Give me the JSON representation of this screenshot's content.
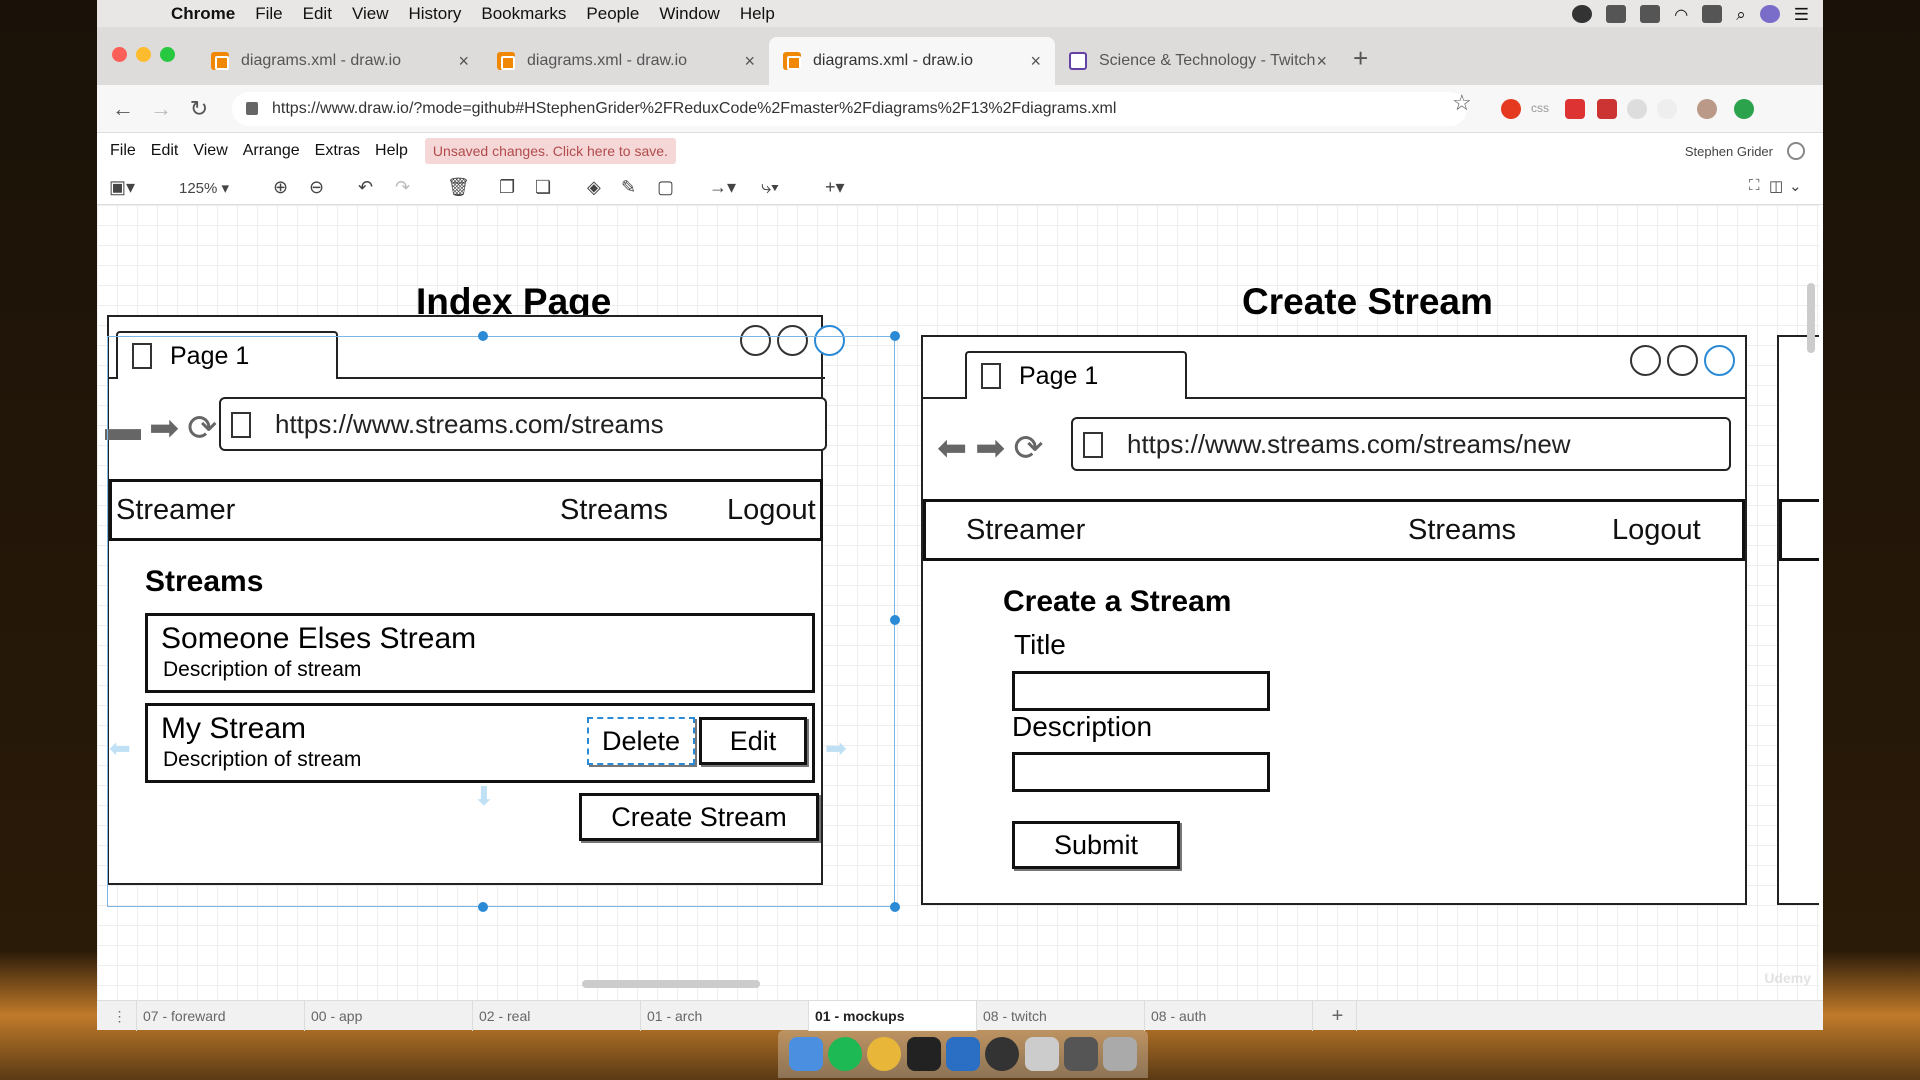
{
  "mac_menubar": {
    "items": [
      "Chrome",
      "File",
      "Edit",
      "View",
      "History",
      "Bookmarks",
      "People",
      "Window",
      "Help"
    ]
  },
  "chrome": {
    "tabs": [
      {
        "title": "diagrams.xml - draw.io",
        "active": false
      },
      {
        "title": "diagrams.xml - draw.io",
        "active": false
      },
      {
        "title": "diagrams.xml - draw.io",
        "active": true
      },
      {
        "title": "Science & Technology - Twitch",
        "active": false
      }
    ],
    "new_tab": "+",
    "url": "https://www.draw.io/?mode=github#HStephenGrider%2FReduxCode%2Fmaster%2Fdiagrams%2F13%2Fdiagrams.xml",
    "ext_label_css": "css"
  },
  "drawio": {
    "menu": [
      "File",
      "Edit",
      "View",
      "Arrange",
      "Extras",
      "Help"
    ],
    "unsaved_notice": "Unsaved changes. Click here to save.",
    "user_name": "Stephen Grider",
    "zoom": "125%"
  },
  "mockups": {
    "index": {
      "title": "Index Page",
      "tab_label": "Page 1",
      "url": "https://www.streams.com/streams",
      "nav": {
        "brand": "Streamer",
        "streams": "Streams",
        "logout": "Logout"
      },
      "heading": "Streams",
      "items": [
        {
          "title": "Someone Elses Stream",
          "description": "Description of stream"
        },
        {
          "title": "My Stream",
          "description": "Description of stream"
        }
      ],
      "delete_label": "Delete",
      "edit_label": "Edit",
      "create_label": "Create Stream"
    },
    "create": {
      "title": "Create Stream",
      "tab_label": "Page 1",
      "url": "https://www.streams.com/streams/new",
      "nav": {
        "brand": "Streamer",
        "streams": "Streams",
        "logout": "Logout"
      },
      "heading": "Create a Stream",
      "title_label": "Title",
      "description_label": "Description",
      "submit_label": "Submit"
    }
  },
  "page_tabs": [
    {
      "label": "07 - foreward",
      "active": false
    },
    {
      "label": "00 - app",
      "active": false
    },
    {
      "label": "02 - real",
      "active": false
    },
    {
      "label": "01 - arch",
      "active": false
    },
    {
      "label": "01 - mockups",
      "active": true
    },
    {
      "label": "08 - twitch",
      "active": false
    },
    {
      "label": "08 - auth",
      "active": false
    }
  ],
  "add_page": "+",
  "colors": {
    "accent": "#2b8ad6",
    "drawio_orange": "#f08705",
    "unsaved_bg": "#f5d7d7"
  }
}
